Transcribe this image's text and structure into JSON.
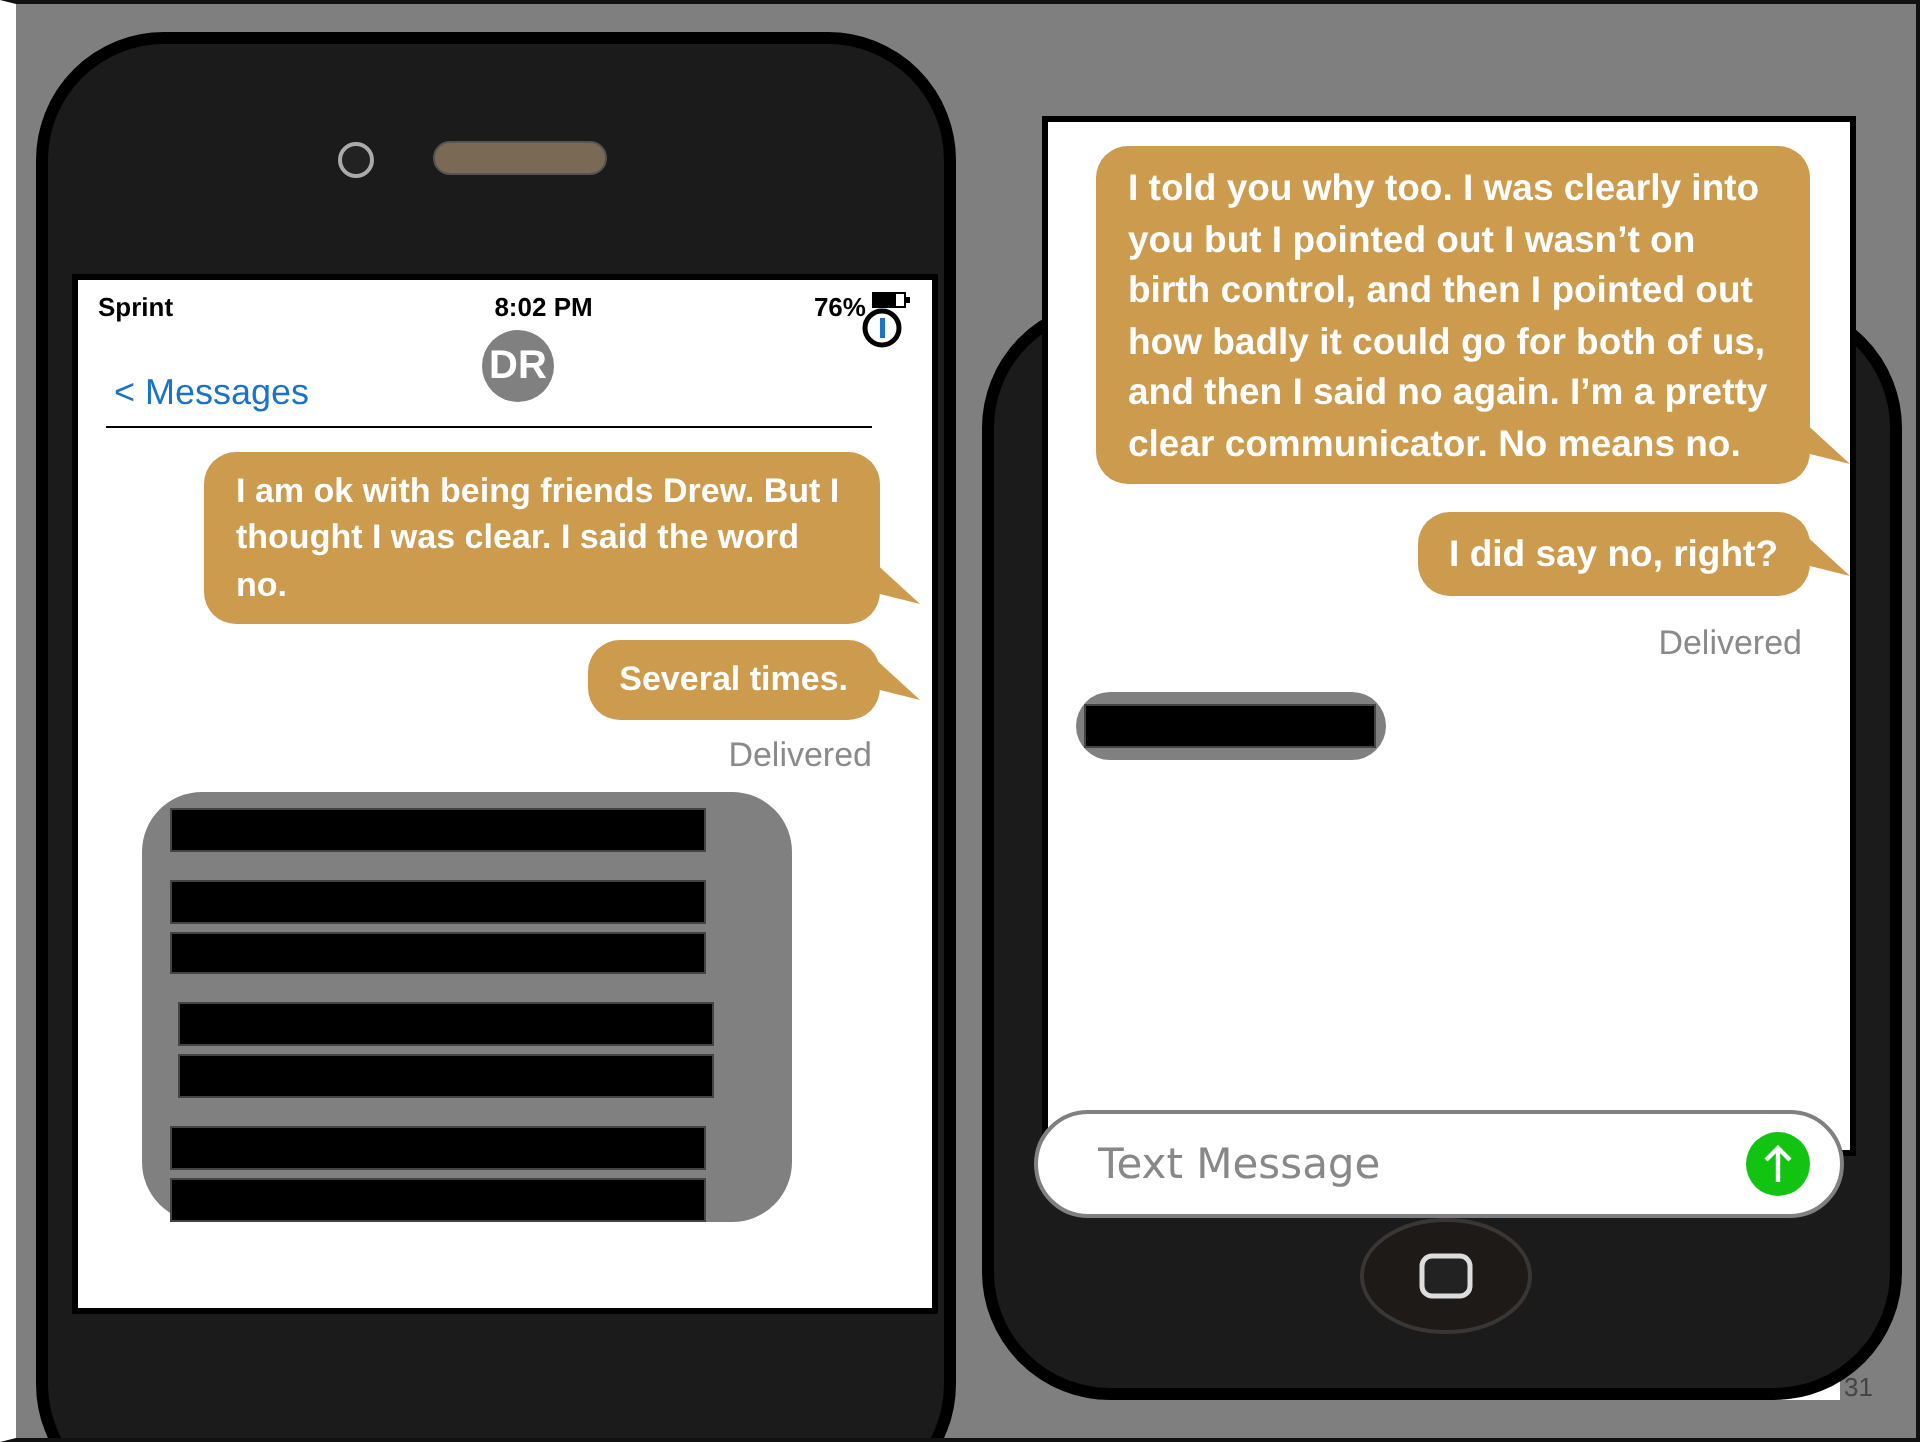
{
  "left_phone": {
    "status_bar": {
      "carrier": "Sprint",
      "time": "8:02 PM",
      "battery": "76%"
    },
    "contact_initials": "DR",
    "back_link": "< Messages",
    "messages": [
      {
        "kind": "sent",
        "text": "I am ok with being friends Drew.  But I thought I was clear. I said the word no."
      },
      {
        "kind": "sent",
        "text": "Several times."
      },
      {
        "kind": "status",
        "text": "Delivered"
      },
      {
        "kind": "redacted_block"
      }
    ]
  },
  "right_phone": {
    "messages": [
      {
        "kind": "sent",
        "text": "I told you why too. I was clearly into you but I pointed out I wasn’t on birth control, and then I pointed out how badly it could go for both of us, and then I said no again. I’m a pretty clear communicator. No means no."
      },
      {
        "kind": "sent",
        "text": "I did say no, right?"
      },
      {
        "kind": "status",
        "text": "Delivered"
      },
      {
        "kind": "redacted_line"
      }
    ],
    "input": {
      "placeholder": "Text Message"
    }
  },
  "page_number": "31"
}
